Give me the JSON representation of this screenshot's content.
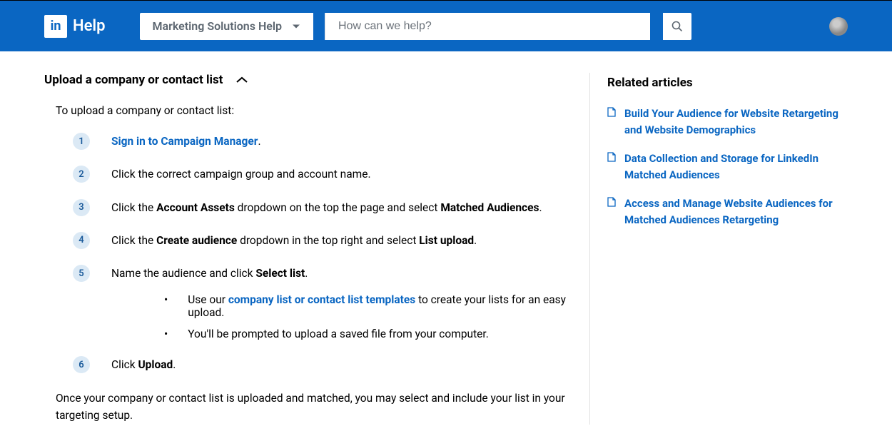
{
  "header": {
    "logo_text": "in",
    "help_label": "Help",
    "topic_label": "Marketing Solutions Help",
    "search_placeholder": "How can we help?"
  },
  "main": {
    "title": "Upload a company or contact list",
    "intro": "To upload a company or contact list:",
    "steps": [
      {
        "num": "1",
        "parts": [
          {
            "type": "link",
            "text": "Sign in to Campaign Manager"
          },
          {
            "type": "text",
            "text": "."
          }
        ]
      },
      {
        "num": "2",
        "parts": [
          {
            "type": "text",
            "text": "Click the correct campaign group and account name."
          }
        ]
      },
      {
        "num": "3",
        "parts": [
          {
            "type": "text",
            "text": "Click the "
          },
          {
            "type": "bold",
            "text": "Account Assets"
          },
          {
            "type": "text",
            "text": " dropdown on the top the page and select "
          },
          {
            "type": "bold",
            "text": "Matched Audiences"
          },
          {
            "type": "text",
            "text": "."
          }
        ]
      },
      {
        "num": "4",
        "parts": [
          {
            "type": "text",
            "text": "Click the "
          },
          {
            "type": "bold",
            "text": "Create audience"
          },
          {
            "type": "text",
            "text": " dropdown in the top right and select "
          },
          {
            "type": "bold",
            "text": "List upload"
          },
          {
            "type": "text",
            "text": "."
          }
        ]
      },
      {
        "num": "5",
        "parts": [
          {
            "type": "text",
            "text": "Name the audience and click "
          },
          {
            "type": "bold",
            "text": "Select list"
          },
          {
            "type": "text",
            "text": "."
          }
        ]
      },
      {
        "num": "6",
        "parts": [
          {
            "type": "text",
            "text": "Click "
          },
          {
            "type": "bold",
            "text": "Upload"
          },
          {
            "type": "text",
            "text": "."
          }
        ]
      }
    ],
    "sub_bullets": [
      {
        "parts": [
          {
            "type": "text",
            "text": "Use our "
          },
          {
            "type": "link",
            "text": "company list or contact list templates"
          },
          {
            "type": "text",
            "text": " to create your lists for an easy upload."
          }
        ]
      },
      {
        "parts": [
          {
            "type": "text",
            "text": "You'll be prompted to upload a saved file from your computer."
          }
        ]
      }
    ],
    "outro": "Once your company or contact list is uploaded and matched, you may select and include your list in your targeting setup."
  },
  "sidebar": {
    "title": "Related articles",
    "items": [
      "Build Your Audience for Website Retargeting and Website Demographics",
      "Data Collection and Storage for LinkedIn Matched Audiences",
      "Access and Manage Website Audiences for Matched Audiences Retargeting"
    ]
  }
}
